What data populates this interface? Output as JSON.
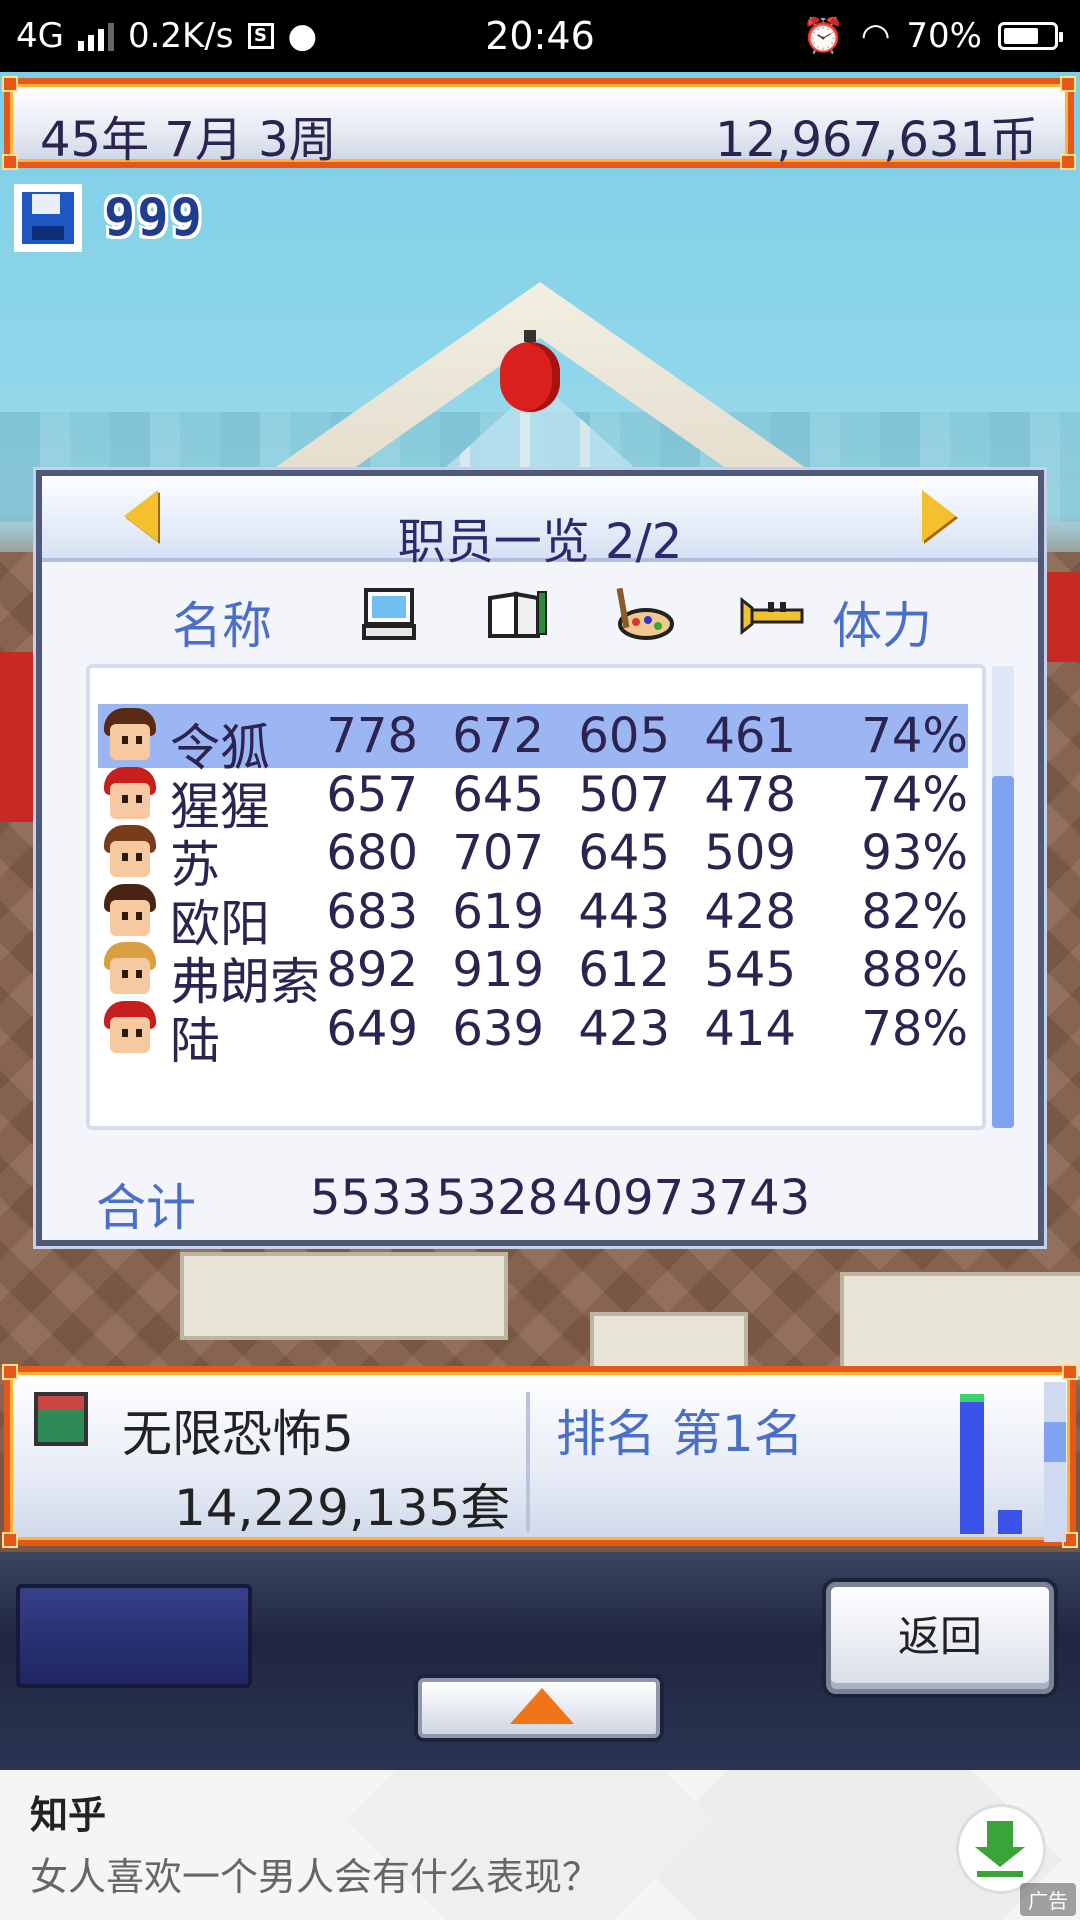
{
  "status_bar": {
    "network": "4G",
    "speed": "0.2K/s",
    "time": "20:46",
    "battery_text": "70%",
    "battery_level": 0.7,
    "icons": [
      "signal-icon",
      "sim-s-icon",
      "chat-bubble-icon",
      "alarm-icon",
      "wifi-icon",
      "battery-icon"
    ]
  },
  "topbar": {
    "date": "45年 7月 3周",
    "money": "12,967,631币"
  },
  "save": {
    "icon": "floppy-disk-icon",
    "count": "999"
  },
  "staff_panel": {
    "title": "职员一览 2/2",
    "headers": {
      "name": "名称",
      "programming_icon": "computer-icon",
      "scenario_icon": "book-pen-icon",
      "graphics_icon": "palette-icon",
      "sound_icon": "trumpet-icon",
      "stamina": "体力"
    },
    "rows": [
      {
        "name": "令狐",
        "v1": "778",
        "v2": "672",
        "v3": "605",
        "v4": "461",
        "stamina": "74%",
        "selected": true
      },
      {
        "name": "猩猩",
        "v1": "657",
        "v2": "645",
        "v3": "507",
        "v4": "478",
        "stamina": "74%",
        "selected": false
      },
      {
        "name": "苏",
        "v1": "680",
        "v2": "707",
        "v3": "645",
        "v4": "509",
        "stamina": "93%",
        "selected": false
      },
      {
        "name": "欧阳",
        "v1": "683",
        "v2": "619",
        "v3": "443",
        "v4": "428",
        "stamina": "82%",
        "selected": false
      },
      {
        "name": "弗朗索",
        "v1": "892",
        "v2": "919",
        "v3": "612",
        "v4": "545",
        "stamina": "88%",
        "selected": false
      },
      {
        "name": "陆",
        "v1": "649",
        "v2": "639",
        "v3": "423",
        "v4": "414",
        "stamina": "78%",
        "selected": false
      }
    ],
    "total_label": "合计",
    "totals": [
      "5533",
      "5328",
      "4097",
      "3743"
    ]
  },
  "game_bar": {
    "game_name": "无限恐怖5",
    "sales": "14,229,135套",
    "rank": "排名 第1名"
  },
  "controls": {
    "back_label": "返回"
  },
  "ad": {
    "brand": "知乎",
    "text": "女人喜欢一个男人会有什么表现？",
    "tag": "广告"
  }
}
